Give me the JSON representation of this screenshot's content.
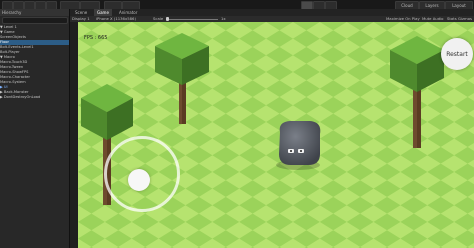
{
  "toolbar": {
    "play_icon": "play-icon",
    "pause_icon": "pause-icon",
    "step_icon": "step-icon",
    "account_label": "Cloud",
    "layers_label": "Layers",
    "layout_label": "Layout"
  },
  "hierarchy": {
    "title": "Hierarchy",
    "items": [
      {
        "label": "▼ Level 1"
      },
      {
        "label": "  ▼ Game"
      },
      {
        "label": "    ScreenObjects"
      },
      {
        "label": "    Floor"
      },
      {
        "label": "    Bolt-Events-Level1"
      },
      {
        "label": "    Bolt-Player"
      },
      {
        "label": "  ▼ Macro"
      },
      {
        "label": "    Macro-Touch3D"
      },
      {
        "label": "    Macro-Tween"
      },
      {
        "label": "    Macro-ShowFPS"
      },
      {
        "label": "    Macro-Character"
      },
      {
        "label": "    Macro-System"
      },
      {
        "label": "  ▶ UI"
      },
      {
        "label": "  ▶ Back-Monster"
      },
      {
        "label": "▶ DontDestroyOnLoad"
      }
    ]
  },
  "view_tabs": [
    "Scene",
    "Game",
    "Animator"
  ],
  "game_bar": {
    "display": "Display 1",
    "resolution": "iPhone X (1136x586)",
    "scale_label": "Scale",
    "scale_value": "1x",
    "maximize": "Maximize On Play",
    "mute": "Mute Audio",
    "stats": "Stats",
    "gizmos": "Gizmos"
  },
  "game": {
    "fps_text": "FPS : 665",
    "restart_label": "Restart"
  }
}
